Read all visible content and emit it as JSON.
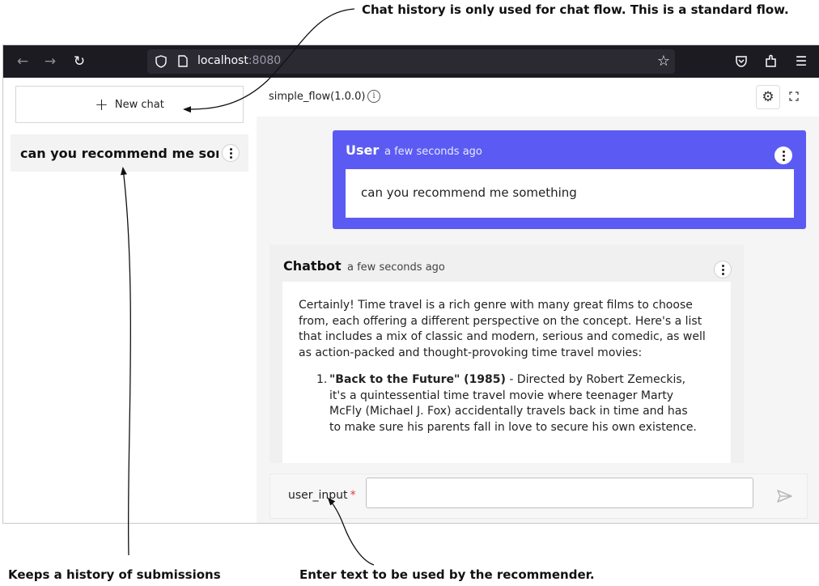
{
  "annotations": {
    "top": "Chat history is only used for chat flow. This is a standard flow.",
    "bottom_left": "Keeps a history of submissions",
    "bottom_center": "Enter text to be used by the recommender."
  },
  "browser": {
    "url_host": "localhost",
    "url_port": ":8080"
  },
  "sidebar": {
    "new_chat_label": "New chat",
    "history": [
      {
        "title": "can you recommend me something"
      }
    ]
  },
  "main": {
    "flow_title": "simple_flow(1.0.0)",
    "messages": {
      "user": {
        "sender": "User",
        "time": "a few seconds ago",
        "text": "can you recommend me something"
      },
      "bot": {
        "sender": "Chatbot",
        "time": "a few seconds ago",
        "intro": "Certainly! Time travel is a rich genre with many great films to choose from, each offering a different perspective on the concept. Here's a list that includes a mix of classic and modern, serious and comedic, as well as action-packed and thought-provoking time travel movies:",
        "list": [
          {
            "number": "1.",
            "title": "\"Back to the Future\" (1985)",
            "description": " - Directed by Robert Zemeckis, it's a quintessential time travel movie where teenager Marty McFly (Michael J. Fox) accidentally travels back in time and has to make sure his parents fall in love to secure his own existence."
          }
        ]
      }
    },
    "input": {
      "label": "user_input",
      "required_mark": "*",
      "value": ""
    }
  },
  "colors": {
    "user_bubble": "#5b5bf3",
    "browser_toolbar": "#1c1b22",
    "required": "#e53935"
  }
}
